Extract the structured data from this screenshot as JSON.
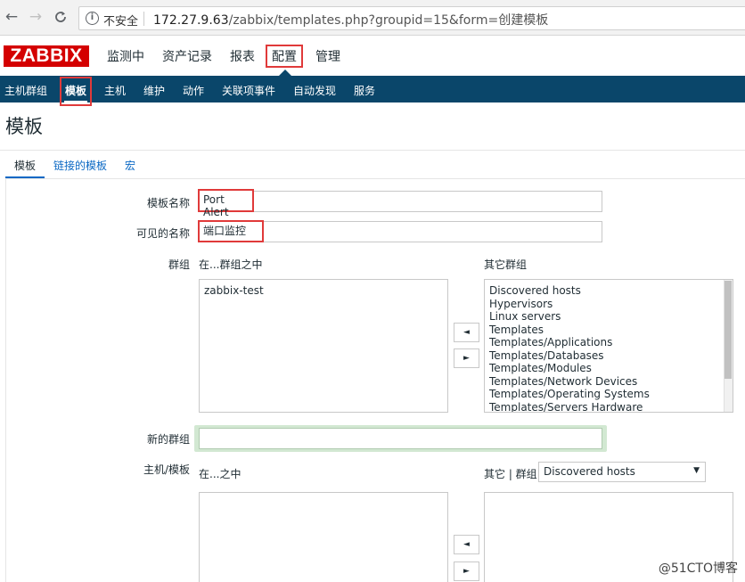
{
  "browser": {
    "back": "←",
    "forward": "→",
    "reload": "C",
    "insecure_label": "不安全",
    "url_host": "172.27.9.63",
    "url_path": "/zabbix/templates.php?groupid=15&form=创建模板"
  },
  "header": {
    "logo": "ZABBIX",
    "main_menu": [
      "监测中",
      "资产记录",
      "报表",
      "配置",
      "管理"
    ],
    "active_menu": "配置"
  },
  "subnav": {
    "items": [
      "主机群组",
      "模板",
      "主机",
      "维护",
      "动作",
      "关联项事件",
      "自动发现",
      "服务"
    ],
    "active_item": "模板"
  },
  "page_title": "模板",
  "tabs": [
    "模板",
    "链接的模板",
    "宏"
  ],
  "form": {
    "template_name_label": "模板名称",
    "template_name_value": "Port Alert",
    "visible_name_label": "可见的名称",
    "visible_name_value": "端口监控",
    "groups_label": "群组",
    "in_groups_header": "在...群组之中",
    "in_groups": [
      "zabbix-test"
    ],
    "other_groups_header": "其它群组",
    "other_groups": [
      "Discovered hosts",
      "Hypervisors",
      "Linux servers",
      "Templates",
      "Templates/Applications",
      "Templates/Databases",
      "Templates/Modules",
      "Templates/Network Devices",
      "Templates/Operating Systems",
      "Templates/Servers Hardware"
    ],
    "move_left": "◄",
    "move_right": "►",
    "new_group_label": "新的群组",
    "new_group_value": "",
    "hosts_templates_label": "主机/模板",
    "in_hosts_header": "在...之中",
    "other_hosts_header": "其它 | 群组",
    "other_hosts_group_selected": "Discovered hosts",
    "caret": "▼"
  },
  "watermark": "@51CTO博客",
  "colors": {
    "brand_red": "#d40000",
    "nav_blue": "#0a466a",
    "highlight": "#e03a3a",
    "link_blue": "#0a68c4"
  }
}
